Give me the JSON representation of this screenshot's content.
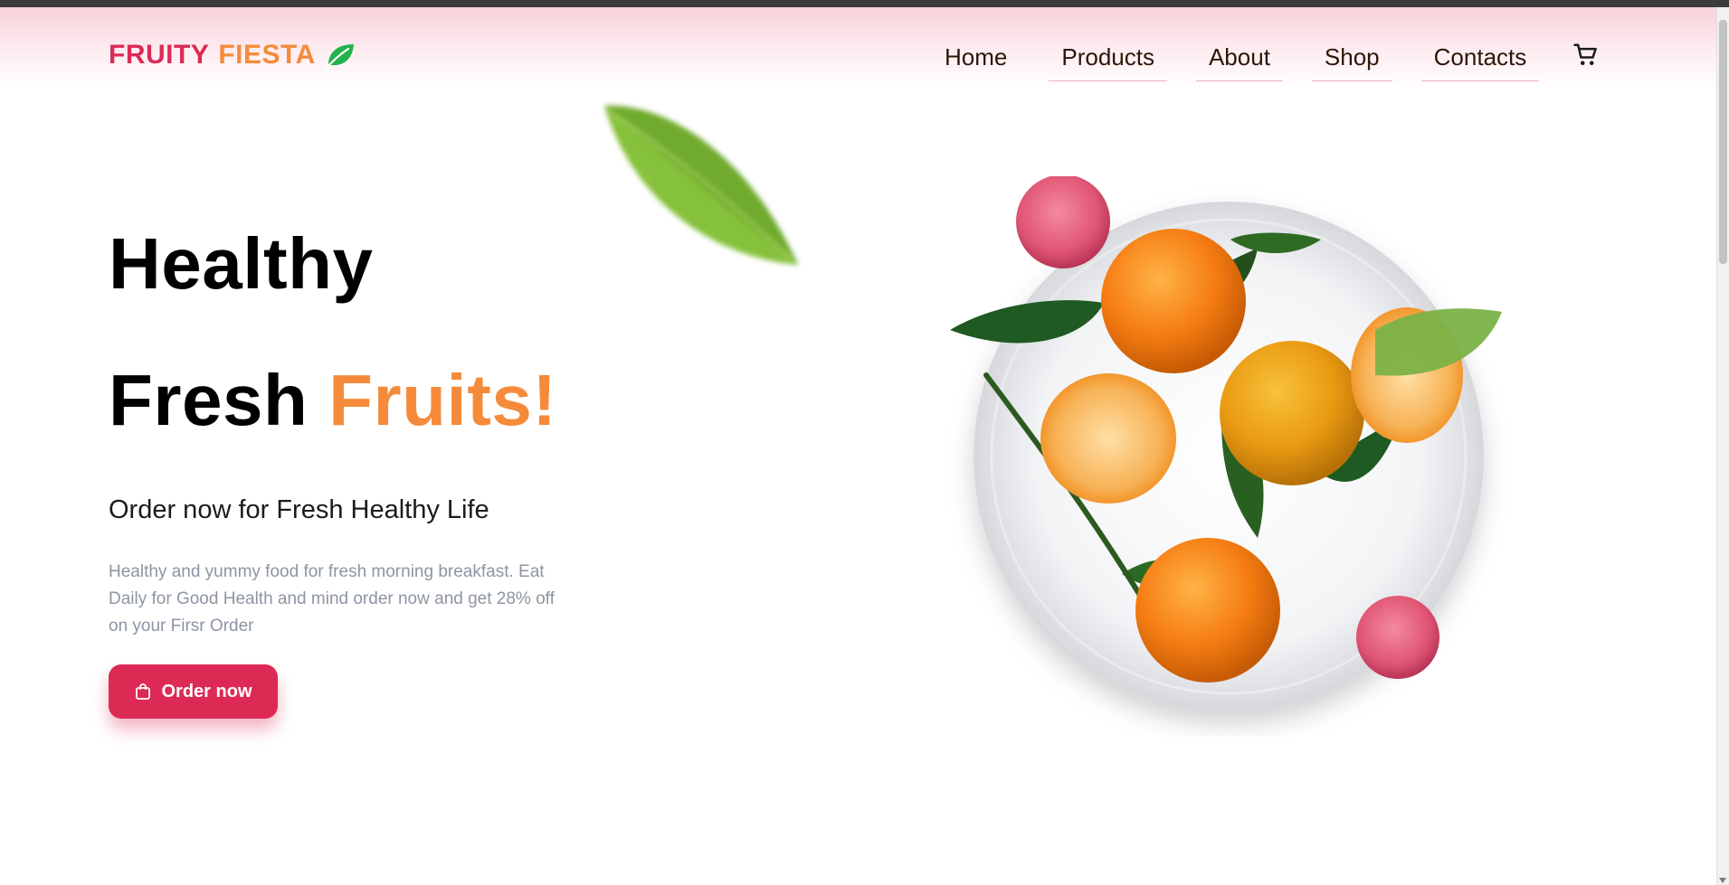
{
  "brand": {
    "word1": "FRUITY",
    "word2": "FIESTA",
    "icon": "leaf-icon"
  },
  "nav": {
    "items": [
      {
        "label": "Home"
      },
      {
        "label": "Products"
      },
      {
        "label": "About"
      },
      {
        "label": "Shop"
      },
      {
        "label": "Contacts"
      }
    ],
    "cart_icon": "cart-icon"
  },
  "hero": {
    "title_line1": "Healthy",
    "title_line2_word": "Fresh",
    "title_line2_accent": "Fruits!",
    "subtitle": "Order now for Fresh Healthy Life",
    "description": "Healthy and yummy food for fresh morning breakfast. Eat Daily for Good Health and mind order now and get 28% off on your Firsr Order",
    "cta_label": "Order now",
    "cta_icon": "shopping-bag-icon"
  },
  "colors": {
    "primary": "#dd2a55",
    "accent": "#f58b3a",
    "nav_text": "#2e1608",
    "desc_text": "#8d95a3"
  }
}
